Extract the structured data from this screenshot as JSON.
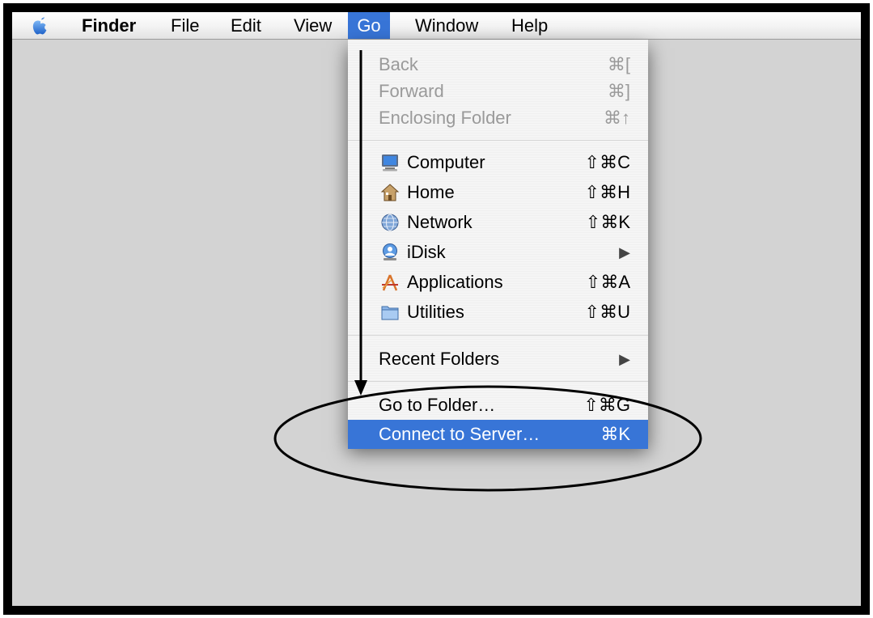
{
  "menubar": {
    "apple_icon": "apple-icon",
    "items": [
      "Finder",
      "File",
      "Edit",
      "View",
      "Go",
      "Window",
      "Help"
    ],
    "active": "Go"
  },
  "go_menu": {
    "nav": [
      {
        "label": "Back",
        "shortcut": "⌘[",
        "enabled": false
      },
      {
        "label": "Forward",
        "shortcut": "⌘]",
        "enabled": false
      },
      {
        "label": "Enclosing Folder",
        "shortcut": "⌘↑",
        "enabled": false
      }
    ],
    "places": [
      {
        "label": "Computer",
        "shortcut": "⇧⌘C",
        "icon": "computer-icon"
      },
      {
        "label": "Home",
        "shortcut": "⇧⌘H",
        "icon": "home-icon"
      },
      {
        "label": "Network",
        "shortcut": "⇧⌘K",
        "icon": "network-icon"
      },
      {
        "label": "iDisk",
        "submenu_arrow": "▶",
        "icon": "idisk-icon"
      },
      {
        "label": "Applications",
        "shortcut": "⇧⌘A",
        "icon": "applications-icon"
      },
      {
        "label": "Utilities",
        "shortcut": "⇧⌘U",
        "icon": "utilities-folder-icon"
      }
    ],
    "recent": {
      "label": "Recent Folders",
      "submenu_arrow": "▶"
    },
    "goto": {
      "label": "Go to Folder…",
      "shortcut": "⇧⌘G"
    },
    "connect": {
      "label": "Connect to Server…",
      "shortcut": "⌘K",
      "highlighted": true
    }
  },
  "colors": {
    "highlight": "#3875d7",
    "desktop": "#d3d3d3",
    "disabled_text": "#9a9a9a"
  }
}
